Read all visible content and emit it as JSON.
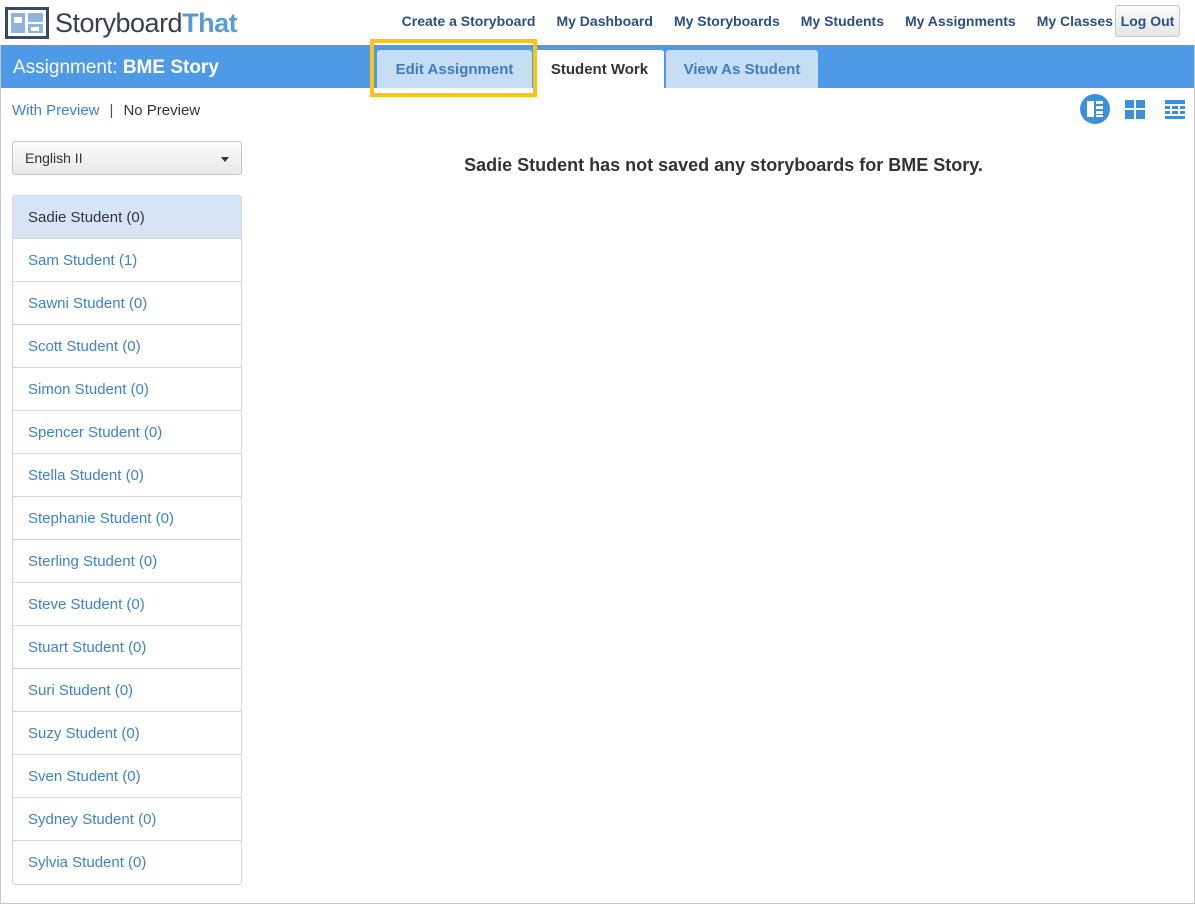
{
  "brand": {
    "name_part1": "Storyboard",
    "name_part2": "That"
  },
  "nav": {
    "items": [
      {
        "label": "Create a Storyboard"
      },
      {
        "label": "My Dashboard"
      },
      {
        "label": "My Storyboards"
      },
      {
        "label": "My Students"
      },
      {
        "label": "My Assignments"
      },
      {
        "label": "My Classes"
      }
    ],
    "logout_label": "Log Out"
  },
  "header": {
    "prefix": "Assignment: ",
    "assignment_name": "BME Story",
    "tabs": [
      {
        "label": "Edit Assignment",
        "highlighted": true
      },
      {
        "label": "Student Work",
        "active": true
      },
      {
        "label": "View As Student"
      }
    ]
  },
  "preview_toggle": {
    "with_label": "With Preview",
    "separator": "|",
    "without_label": "No Preview"
  },
  "view_icons": [
    "list-view-icon",
    "grid-view-icon",
    "rows-view-icon"
  ],
  "class_select": {
    "selected": "English II"
  },
  "students": [
    {
      "label": "Sadie Student (0)",
      "active": true
    },
    {
      "label": "Sam Student (1)"
    },
    {
      "label": "Sawni Student (0)"
    },
    {
      "label": "Scott Student (0)"
    },
    {
      "label": "Simon Student (0)"
    },
    {
      "label": "Spencer Student (0)"
    },
    {
      "label": "Stella Student (0)"
    },
    {
      "label": "Stephanie Student (0)"
    },
    {
      "label": "Sterling Student (0)"
    },
    {
      "label": "Steve Student (0)"
    },
    {
      "label": "Stuart Student (0)"
    },
    {
      "label": "Suri Student (0)"
    },
    {
      "label": "Suzy Student (0)"
    },
    {
      "label": "Sven Student (0)"
    },
    {
      "label": "Sydney Student (0)"
    },
    {
      "label": "Sylvia Student (0)"
    }
  ],
  "main": {
    "message": "Sadie Student has not saved any storyboards for BME Story."
  },
  "colors": {
    "header_blue": "#4f9ae6",
    "highlight": "#f5c518",
    "link_blue": "#3d83c8",
    "nav_blue": "#2b4f80"
  }
}
